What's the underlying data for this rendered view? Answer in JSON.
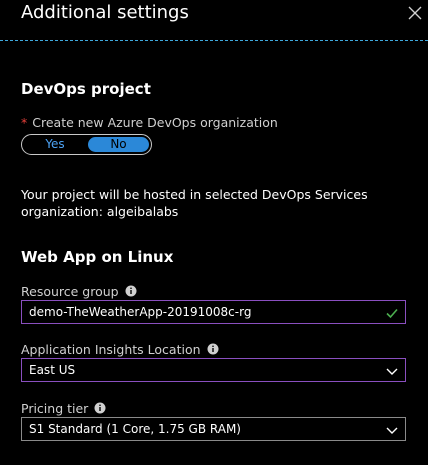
{
  "header": {
    "title": "Additional settings"
  },
  "devops": {
    "section_title": "DevOps project",
    "required_mark": "*",
    "create_org_label": "Create new Azure DevOps organization",
    "toggle": {
      "yes_label": "Yes",
      "no_label": "No",
      "selected": "No"
    },
    "hosting_info": "Your project will be hosted in selected DevOps Services organization: algeibalabs"
  },
  "webapp": {
    "section_title": "Web App on Linux",
    "resource_group": {
      "label": "Resource group",
      "value": "demo-TheWeatherApp-20191008c-rg",
      "valid": true
    },
    "insights_location": {
      "label": "Application Insights Location",
      "value": "East US"
    },
    "pricing_tier": {
      "label": "Pricing tier",
      "value": "S1 Standard (1 Core, 1.75 GB RAM)"
    }
  },
  "colors": {
    "accent": "#2b88d8",
    "divider": "#3fa9de",
    "required": "#e8403a",
    "valid_check": "#4caf50",
    "focused_border": "#8a4fbf"
  }
}
